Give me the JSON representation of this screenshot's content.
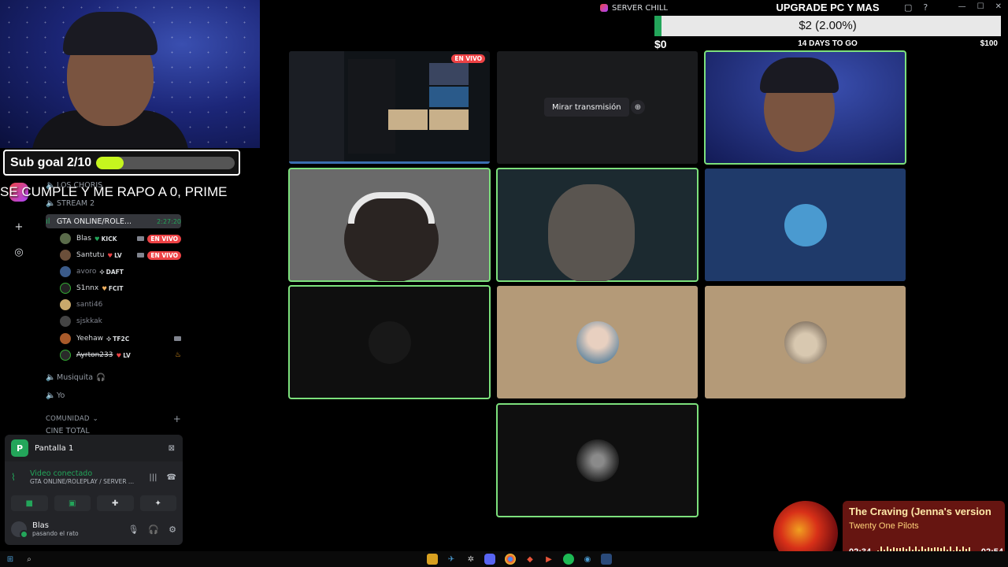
{
  "window": {
    "title": "SERVER CHILL"
  },
  "stream_overlay": {
    "sub_goal": {
      "label": "Sub goal 2/10",
      "progress": 0.2
    },
    "marquee": "SE CUMPLE Y ME RAPO A 0, PRIME",
    "donation": {
      "title": "UPGRADE PC Y MAS",
      "amount": "$2 (2.00%)",
      "progress": 0.02,
      "min": "$0",
      "days_left": "14 DAYS TO GO",
      "max": "$100"
    }
  },
  "sidebar": {
    "channels_top": [
      {
        "label": "LOS CHORIS"
      },
      {
        "label": "STREAM 2"
      }
    ],
    "active_channel": {
      "label": "GTA ONLINE/ROLE...",
      "time": "2:27:20"
    },
    "users": [
      {
        "name": "Blas",
        "tag": "KICK",
        "live": "EN VIVO",
        "color": "#5a6b4a"
      },
      {
        "name": "Santutu",
        "tag": "LV",
        "live": "EN VIVO",
        "color": "#6b4f3a"
      },
      {
        "name": "avoro",
        "tag": "DAFT",
        "live": "",
        "color": "#3b5b8a"
      },
      {
        "name": "S1nnx",
        "tag": "FCIT",
        "live": "",
        "color": "#222"
      },
      {
        "name": "santi46",
        "tag": "",
        "live": "",
        "color": "#c9a86b"
      },
      {
        "name": "sjskkak",
        "tag": "",
        "live": "",
        "color": "#444"
      },
      {
        "name": "Yeehaw",
        "tag": "TF2C",
        "live": "",
        "color": "#a85a2a"
      },
      {
        "name": "Ayrton233",
        "tag": "LV",
        "live": "",
        "color": "#2a2a2a"
      }
    ],
    "channels_bottom": [
      {
        "label": "Musiquita"
      },
      {
        "label": "Yo"
      }
    ],
    "category": "COMUNIDAD",
    "cut_channel": "CINE TOTAL"
  },
  "voice_panel": {
    "screen_label": "Pantalla 1",
    "screen_initial": "P",
    "status": "Video conectado",
    "channel": "GTA ONLINE/ROLEPLAY / SERVER ...",
    "user": {
      "name": "Blas",
      "status": "pasando el rato"
    }
  },
  "grid": {
    "live_badge": "EN VIVO",
    "watch_label": "Mirar transmisión"
  },
  "music": {
    "song": "The Craving (Jenna's version",
    "artist": "Twenty One Pilots",
    "current": "02:34",
    "duration": "02:54"
  },
  "colors": {
    "accent_green": "#23a55a",
    "speaking_outline": "#7ce07c",
    "live_red": "#ed4245",
    "tan_tile": "#b49a78",
    "blue_tile": "#1f3a6a"
  }
}
